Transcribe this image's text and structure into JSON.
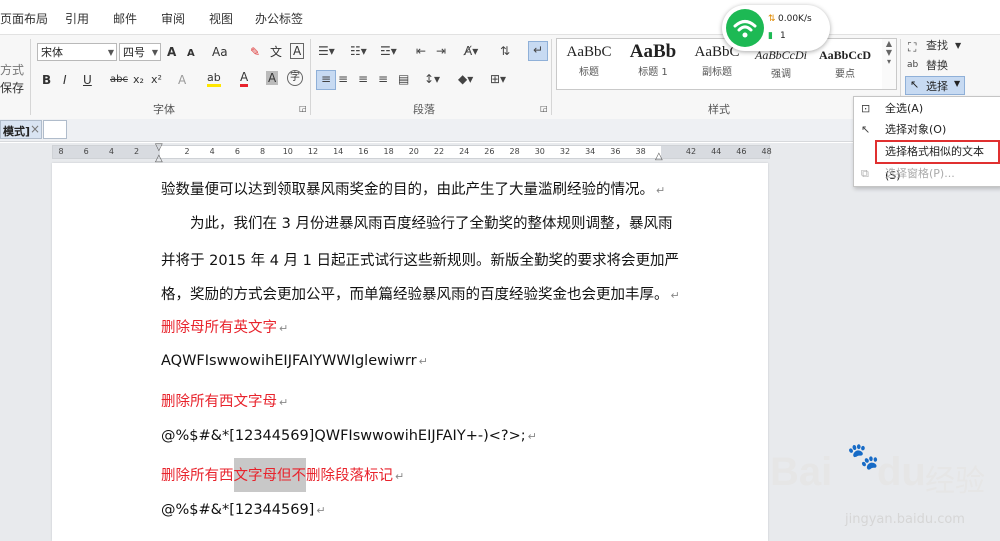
{
  "menu": {
    "items": [
      "页面布局",
      "引用",
      "邮件",
      "审阅",
      "视图",
      "办公标签"
    ]
  },
  "ribbon": {
    "left_partial": [
      "方式",
      "保存"
    ],
    "font": {
      "name": "宋体",
      "size": "四号",
      "grow": "A",
      "shrink": "A",
      "case": "Aa",
      "clear_format": "✎",
      "phonetic": "文",
      "border_char": "A",
      "bold": "B",
      "italic": "I",
      "underline": "U",
      "strike": "abc",
      "sub": "x₂",
      "sup": "x²",
      "text_effect": "A",
      "highlight": "ab",
      "font_color": "A",
      "char_shade": "A",
      "enclose": "字",
      "group_label": "字体"
    },
    "paragraph": {
      "group_label": "段落"
    },
    "styles": {
      "group_label": "样式",
      "items": [
        {
          "preview": "AaBbC",
          "name": "标题"
        },
        {
          "preview": "AaBb",
          "name": "标题 1"
        },
        {
          "preview": "AaBbC",
          "name": "副标题"
        },
        {
          "preview": "AaBbCcDi",
          "name": "强调"
        },
        {
          "preview": "AaBbCcD",
          "name": "要点"
        }
      ]
    },
    "editing": {
      "find": "查找",
      "replace": "替换",
      "select": "选择"
    }
  },
  "network": {
    "speed": "0.00K/s",
    "count": "1"
  },
  "tab": {
    "label": "模式]",
    "close": "×"
  },
  "ruler": {
    "numbers": [
      "8",
      "6",
      "4",
      "2",
      "",
      "2",
      "4",
      "6",
      "8",
      "10",
      "12",
      "14",
      "16",
      "18",
      "20",
      "22",
      "24",
      "26",
      "28",
      "30",
      "32",
      "34",
      "36",
      "38",
      "",
      "42",
      "44",
      "46",
      "48"
    ]
  },
  "document": {
    "lines": [
      {
        "text": "验数量便可以达到领取暴风雨奖金的目的，由此产生了大量滥刷经验的情况。",
        "mark": "↵",
        "red": false
      },
      {
        "text": "为此，我们在 3 月份进暴风雨百度经验行了全勤奖的整体规则调整，暴风雨",
        "mark": "",
        "red": false
      },
      {
        "text": "并将于 2015 年 4 月 1 日起正式试行这些新规则。新版全勤奖的要求将会更加严",
        "mark": "",
        "red": false
      },
      {
        "text": "格，奖励的方式会更加公平，而单篇经验暴风雨的百度经验奖金也会更加丰厚。",
        "mark": "↵",
        "red": false
      },
      {
        "text": "删除母所有英文字",
        "mark": "↵",
        "red": true
      },
      {
        "text": "AQWFIswwowihEIJFAIYWWIglewiwrr",
        "mark": "↵",
        "red": false
      },
      {
        "text": "删除所有西文字母",
        "mark": "↵",
        "red": true
      },
      {
        "text": "@%$#&*[12344569]QWFIswwowihEIJFAIY+-)<?>;",
        "mark": "↵",
        "red": false
      },
      {
        "text_pre": "删除所有西",
        "text_hl": "文字母但不",
        "text_post": "删除段落标记",
        "mark": "↵",
        "red": true
      },
      {
        "text": "@%$#&*[12344569]",
        "mark": "↵",
        "red": false
      }
    ]
  },
  "dropdown": {
    "items": [
      {
        "label": "全选(A)",
        "icon": "select-all-icon",
        "disabled": false
      },
      {
        "label": "选择对象(O)",
        "icon": "pointer-icon",
        "disabled": false
      },
      {
        "label": "选择格式相似的文本(S)",
        "icon": "",
        "disabled": false
      },
      {
        "label": "选择窗格(P)...",
        "icon": "selection-pane-icon",
        "disabled": true
      }
    ]
  },
  "watermark": {
    "brand": "Bai",
    "brand2": "du",
    "cn": "经验",
    "url": "jingyan.baidu.com"
  },
  "colors": {
    "red_text": "#e8232c",
    "highlight_border": "#e03030",
    "wifi_green": "#1db954"
  }
}
